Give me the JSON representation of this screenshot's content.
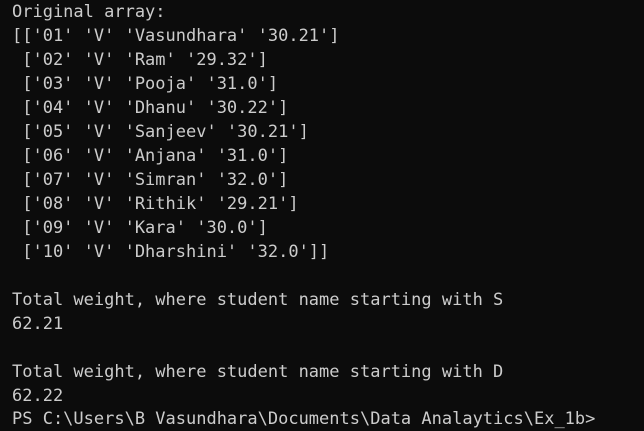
{
  "terminal": {
    "lines": [
      "Original array:",
      "[['01' 'V' 'Vasundhara' '30.21']",
      " ['02' 'V' 'Ram' '29.32']",
      " ['03' 'V' 'Pooja' '31.0']",
      " ['04' 'V' 'Dhanu' '30.22']",
      " ['05' 'V' 'Sanjeev' '30.21']",
      " ['06' 'V' 'Anjana' '31.0']",
      " ['07' 'V' 'Simran' '32.0']",
      " ['08' 'V' 'Rithik' '29.21']",
      " ['09' 'V' 'Kara' '30.0']",
      " ['10' 'V' 'Dharshini' '32.0']]",
      "",
      "Total weight, where student name starting with S",
      "62.21",
      "",
      "Total weight, where student name starting with D",
      "62.22",
      "PS C:\\Users\\B Vasundhara\\Documents\\Data Analaytics\\Ex_1b>"
    ]
  }
}
